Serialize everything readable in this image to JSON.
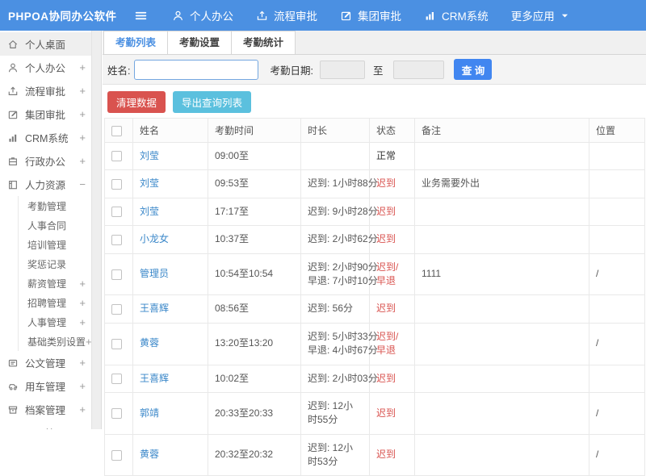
{
  "colors": {
    "header_bg": "#4b90e2",
    "primary": "#4186f0",
    "danger": "#d9534f",
    "info": "#5bc0de",
    "link": "#3a87c9",
    "tab_active": "#4b90e2"
  },
  "app": {
    "logo": "PHPOA协同办公软件"
  },
  "ui": {
    "plus": "+",
    "minus": "−"
  },
  "header": {
    "nav": [
      {
        "icon": "user",
        "label": "个人办公"
      },
      {
        "icon": "share",
        "label": "流程审批"
      },
      {
        "icon": "edit",
        "label": "集团审批"
      },
      {
        "icon": "chart",
        "label": "CRM系统"
      }
    ],
    "more_label": "更多应用"
  },
  "sidebar": {
    "items": [
      {
        "icon": "home",
        "label": "个人桌面",
        "selected": true
      },
      {
        "icon": "user",
        "label": "个人办公",
        "expandable": true
      },
      {
        "icon": "share",
        "label": "流程审批",
        "expandable": true
      },
      {
        "icon": "edit",
        "label": "集团审批",
        "expandable": true
      },
      {
        "icon": "chart",
        "label": "CRM系统",
        "expandable": true
      },
      {
        "icon": "cabinet",
        "label": "行政办公",
        "expandable": true
      },
      {
        "icon": "book",
        "label": "人力资源",
        "expandable": true,
        "expanded": true,
        "children": [
          {
            "label": "考勤管理"
          },
          {
            "label": "人事合同"
          },
          {
            "label": "培训管理"
          },
          {
            "label": "奖惩记录"
          },
          {
            "label": "薪资管理",
            "expandable": true
          },
          {
            "label": "招聘管理",
            "expandable": true
          },
          {
            "label": "人事管理",
            "expandable": true
          },
          {
            "label": "基础类别设置",
            "expandable": true
          }
        ]
      },
      {
        "icon": "doc",
        "label": "公文管理",
        "expandable": true
      },
      {
        "icon": "car",
        "label": "用车管理",
        "expandable": true
      },
      {
        "icon": "archive",
        "label": "档案管理",
        "expandable": true
      },
      {
        "icon": "grid",
        "label": "项目管理",
        "expandable": true
      }
    ]
  },
  "tabs": [
    {
      "label": "考勤列表",
      "active": true
    },
    {
      "label": "考勤设置",
      "active": false
    },
    {
      "label": "考勤统计",
      "active": false
    }
  ],
  "filter": {
    "name_label": "姓名:",
    "name_value": "",
    "date_label": "考勤日期:",
    "date_from": "",
    "to_label": "至",
    "date_to": "",
    "search_label": "查 询"
  },
  "actions": {
    "clean_label": "清理数据",
    "export_label": "导出查询列表"
  },
  "table": {
    "columns": [
      "姓名",
      "考勤时间",
      "时长",
      "状态",
      "备注",
      "位置"
    ],
    "rows": [
      {
        "name": "刘莹",
        "time": "09:00至",
        "duration": [],
        "status": "正常",
        "status_type": "normal",
        "remark": "",
        "location": ""
      },
      {
        "name": "刘莹",
        "time": "09:53至",
        "duration": [
          "迟到: 1小时88分"
        ],
        "status": "迟到",
        "status_type": "late",
        "remark": "业务需要外出",
        "location": ""
      },
      {
        "name": "刘莹",
        "time": "17:17至",
        "duration": [
          "迟到: 9小时28分"
        ],
        "status": "迟到",
        "status_type": "late",
        "remark": "",
        "location": ""
      },
      {
        "name": "小龙女",
        "time": "10:37至",
        "duration": [
          "迟到: 2小时62分"
        ],
        "status": "迟到",
        "status_type": "late",
        "remark": "",
        "location": ""
      },
      {
        "name": "管理员",
        "time": "10:54至10:54",
        "duration": [
          "迟到: 2小时90分",
          "早退: 7小时10分"
        ],
        "status": "迟到/早退",
        "status_type": "late",
        "remark": "1111",
        "location": "/"
      },
      {
        "name": "王喜辉",
        "time": "08:56至",
        "duration": [
          "迟到: 56分"
        ],
        "status": "迟到",
        "status_type": "late",
        "remark": "",
        "location": ""
      },
      {
        "name": "黄蓉",
        "time": "13:20至13:20",
        "duration": [
          "迟到: 5小时33分",
          "早退: 4小时67分"
        ],
        "status": "迟到/早退",
        "status_type": "late",
        "remark": "",
        "location": "/"
      },
      {
        "name": "王喜辉",
        "time": "10:02至",
        "duration": [
          "迟到: 2小时03分"
        ],
        "status": "迟到",
        "status_type": "late",
        "remark": "",
        "location": ""
      },
      {
        "name": "郭靖",
        "time": "20:33至20:33",
        "duration": [
          "迟到: 12小时55分"
        ],
        "wrap": true,
        "status": "迟到",
        "status_type": "late",
        "remark": "",
        "location": "/"
      },
      {
        "name": "黄蓉",
        "time": "20:32至20:32",
        "duration": [
          "迟到: 12小时53分"
        ],
        "wrap": true,
        "status": "迟到",
        "status_type": "late",
        "remark": "",
        "location": "/"
      }
    ]
  }
}
